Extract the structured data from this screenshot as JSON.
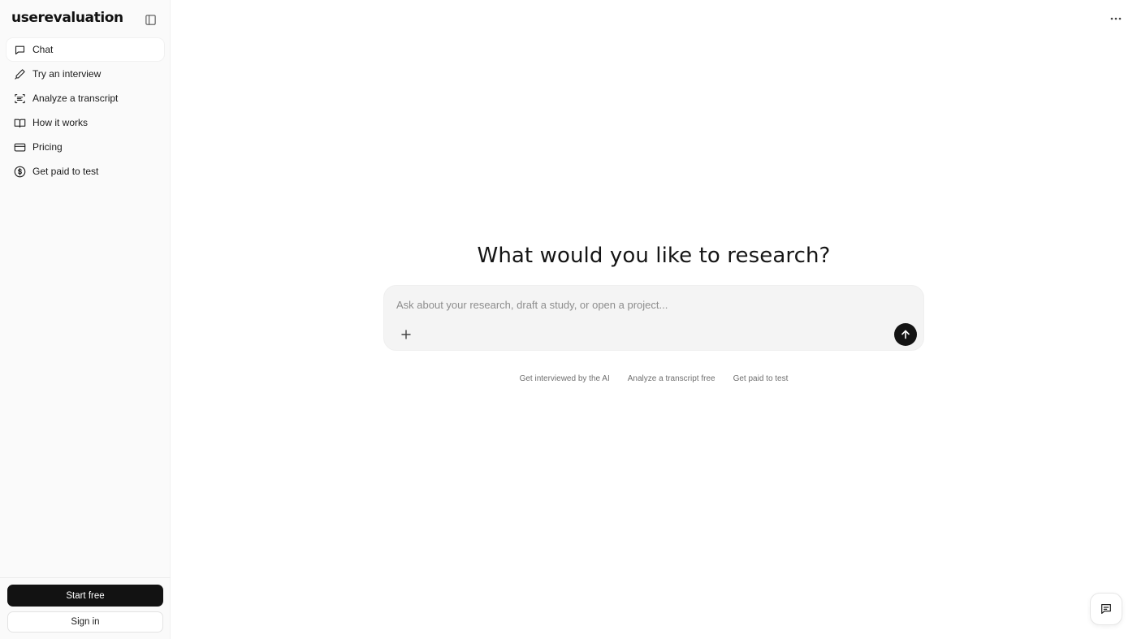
{
  "app": {
    "logo_text": "userevaluation"
  },
  "sidebar": {
    "items": [
      {
        "label": "Chat",
        "icon": "chat-bubble-icon",
        "active": true
      },
      {
        "label": "Try an interview",
        "icon": "pen-icon"
      },
      {
        "label": "Analyze a transcript",
        "icon": "scan-text-icon"
      },
      {
        "label": "How it works",
        "icon": "book-open-icon"
      },
      {
        "label": "Pricing",
        "icon": "credit-card-icon"
      },
      {
        "label": "Get paid to test",
        "icon": "dollar-circle-icon"
      }
    ],
    "start_label": "Start free",
    "signin_label": "Sign in"
  },
  "main": {
    "headline": "What would you like to research?",
    "composer": {
      "placeholder": "Ask about your research, draft a study, or open a project...",
      "value": ""
    },
    "suggestions": [
      "Get interviewed by the AI",
      "Analyze a transcript free",
      "Get paid to test"
    ]
  },
  "colors": {
    "accent": "#121212",
    "sidebar_bg": "#fafafa",
    "composer_bg": "#f4f4f4"
  }
}
